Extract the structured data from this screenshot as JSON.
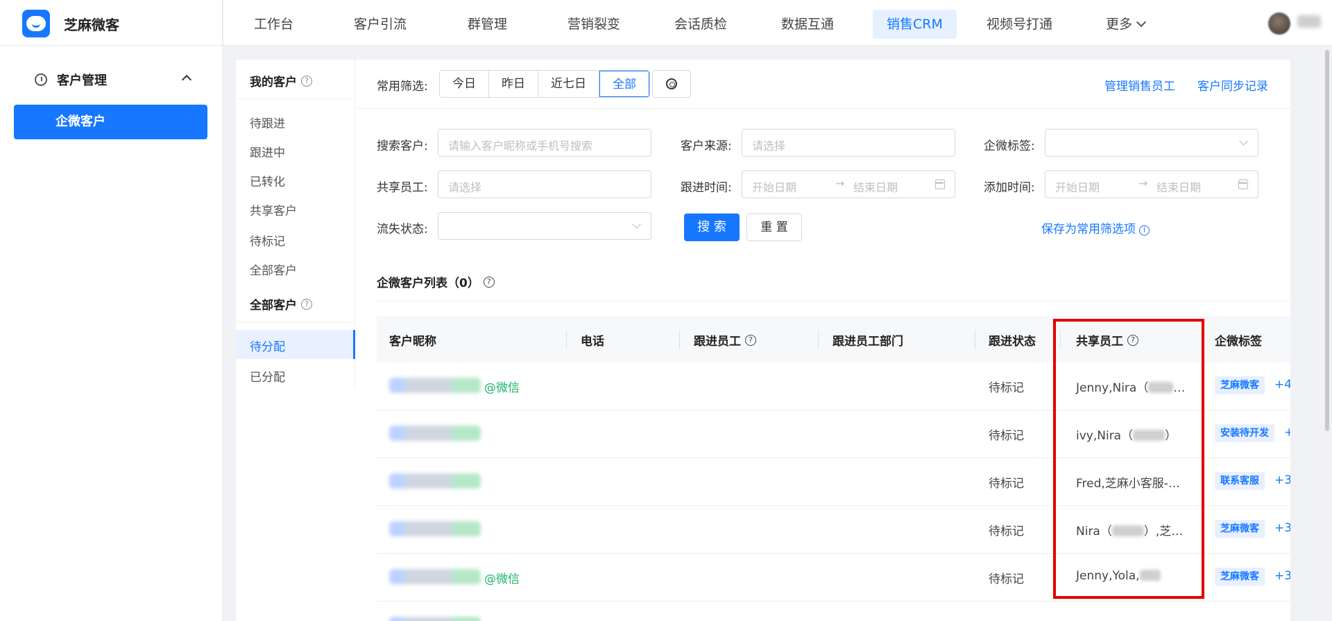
{
  "brand": {
    "name": "芝麻微客"
  },
  "nav": {
    "items": [
      "工作台",
      "客户引流",
      "群管理",
      "营销裂变",
      "会话质检",
      "数据互通",
      "销售CRM",
      "视频号打通"
    ],
    "active": "销售CRM",
    "more_label": "更多"
  },
  "sidebar": {
    "group_label": "客户管理",
    "active_item": "企微客户"
  },
  "subnav": {
    "my_customers": "我的客户",
    "my_items": [
      "待跟进",
      "跟进中",
      "已转化",
      "共享客户",
      "待标记",
      "全部客户"
    ],
    "all_customers": "全部客户",
    "all_items": [
      "待分配",
      "已分配"
    ],
    "selected": "待分配"
  },
  "filters": {
    "common_label": "常用筛选:",
    "segments": [
      "今日",
      "昨日",
      "近七日",
      "全部"
    ],
    "active_segment": "全部",
    "manage_staff_link": "管理销售员工",
    "sync_log_link": "客户同步记录",
    "search_label": "搜索客户:",
    "search_placeholder": "请输入客户昵称或手机号搜索",
    "source_label": "客户来源:",
    "source_placeholder": "请选择",
    "tag_label": "企微标签:",
    "shared_label": "共享员工:",
    "shared_placeholder": "请选择",
    "follow_time_label": "跟进时间:",
    "add_time_label": "添加时间:",
    "start_placeholder": "开始日期",
    "end_placeholder": "结束日期",
    "range_arrow": "→",
    "lost_label": "流失状态:",
    "search_button": "搜 索",
    "reset_button": "重 置",
    "save_link": "保存为常用筛选项"
  },
  "list": {
    "title": "企微客户列表（0）",
    "columns": [
      "客户昵称",
      "电话",
      "跟进员工",
      "跟进员工部门",
      "跟进状态",
      "共享员工",
      "企微标签"
    ],
    "rows": [
      {
        "wx_suffix": "@微信",
        "status": "待标记",
        "shared": "Jenny,Nira（",
        "shared_tail": "…",
        "tag": "芝麻微客",
        "more": "+4"
      },
      {
        "wx_suffix": "",
        "status": "待标记",
        "shared": "ivy,Nira（",
        "shared_tail": "）",
        "tag": "安装待开发",
        "more": "+"
      },
      {
        "wx_suffix": "",
        "status": "待标记",
        "shared": "Fred,芝麻小客服-…",
        "shared_tail": "",
        "tag": "联系客服",
        "more": "+3"
      },
      {
        "wx_suffix": "",
        "status": "待标记",
        "shared": "Nira（",
        "shared_tail": "）,芝…",
        "tag": "芝麻微客",
        "more": "+3"
      },
      {
        "wx_suffix": "@微信",
        "status": "待标记",
        "shared": "Jenny,Yola,",
        "shared_tail": "",
        "tag": "芝麻微客",
        "more": "+3"
      }
    ]
  }
}
